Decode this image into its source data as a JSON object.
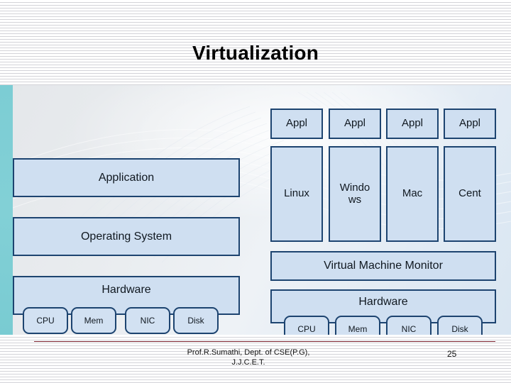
{
  "slide": {
    "title": "Virtualization",
    "page_number": "25",
    "footer_line_1": "Prof.R.Sumathi, Dept. of CSE(P.G),",
    "footer_line_2": "J.J.C.E.T."
  },
  "colors": {
    "box_fill": "#cfdff1",
    "box_border": "#1d4470",
    "teal_band": "#7ccdd4",
    "footer_rule": "#7b2330",
    "background": "#e9ecef"
  },
  "left_diagram": {
    "name": "traditional-stack",
    "layers": [
      {
        "label": "Application"
      },
      {
        "label": "Operating System"
      },
      {
        "label": "Hardware"
      }
    ],
    "hardware_components": [
      {
        "label": "CPU"
      },
      {
        "label": "Mem"
      },
      {
        "label": "NIC"
      },
      {
        "label": "Disk"
      }
    ]
  },
  "right_diagram": {
    "name": "virtualized-stack",
    "applications": [
      {
        "label": "Appl"
      },
      {
        "label": "Appl"
      },
      {
        "label": "Appl"
      },
      {
        "label": "Appl"
      }
    ],
    "guest_os": [
      {
        "label": "Linux"
      },
      {
        "label": "Windows"
      },
      {
        "label": "Mac"
      },
      {
        "label": "Cent"
      }
    ],
    "monitor": {
      "label": "Virtual Machine Monitor"
    },
    "hardware": {
      "label": "Hardware"
    },
    "hardware_components": [
      {
        "label": "CPU"
      },
      {
        "label": "Mem"
      },
      {
        "label": "NIC"
      },
      {
        "label": "Disk"
      }
    ]
  }
}
